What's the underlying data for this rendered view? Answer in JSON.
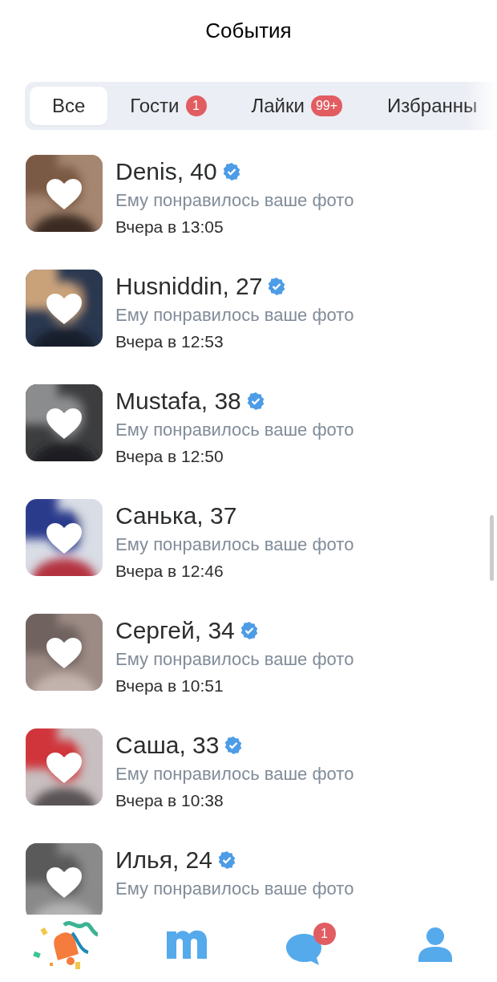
{
  "header": {
    "title": "События"
  },
  "tabs": [
    {
      "label": "Все",
      "selected": true
    },
    {
      "label": "Гости",
      "selected": false,
      "badge": "1"
    },
    {
      "label": "Лайки",
      "selected": false,
      "badge": "99+"
    },
    {
      "label": "Избранны",
      "selected": false
    }
  ],
  "events": [
    {
      "name": "Denis, 40",
      "verified": true,
      "text": "Ему понравилось ваше фото",
      "time": "Вчера в 13:05"
    },
    {
      "name": "Husniddin, 27",
      "verified": true,
      "text": "Ему понравилось ваше фото",
      "time": "Вчера в 12:53"
    },
    {
      "name": "Mustafa, 38",
      "verified": true,
      "text": "Ему понравилось ваше фото",
      "time": "Вчера в 12:50"
    },
    {
      "name": "Санька, 37",
      "verified": false,
      "text": "Ему понравилось ваше фото",
      "time": "Вчера в 12:46"
    },
    {
      "name": "Сергей, 34",
      "verified": true,
      "text": "Ему понравилось ваше фото",
      "time": "Вчера в 10:51"
    },
    {
      "name": "Саша, 33",
      "verified": true,
      "text": "Ему понравилось ваше фото",
      "time": "Вчера в 10:38"
    },
    {
      "name": "Илья, 24",
      "verified": true,
      "text": "Ему понравилось ваше фото"
    }
  ],
  "nav": [
    {
      "kind": "events",
      "selected": true
    },
    {
      "kind": "meet",
      "selected": false
    },
    {
      "kind": "chat",
      "selected": false,
      "badge": "1"
    },
    {
      "kind": "profile",
      "selected": false
    }
  ]
}
